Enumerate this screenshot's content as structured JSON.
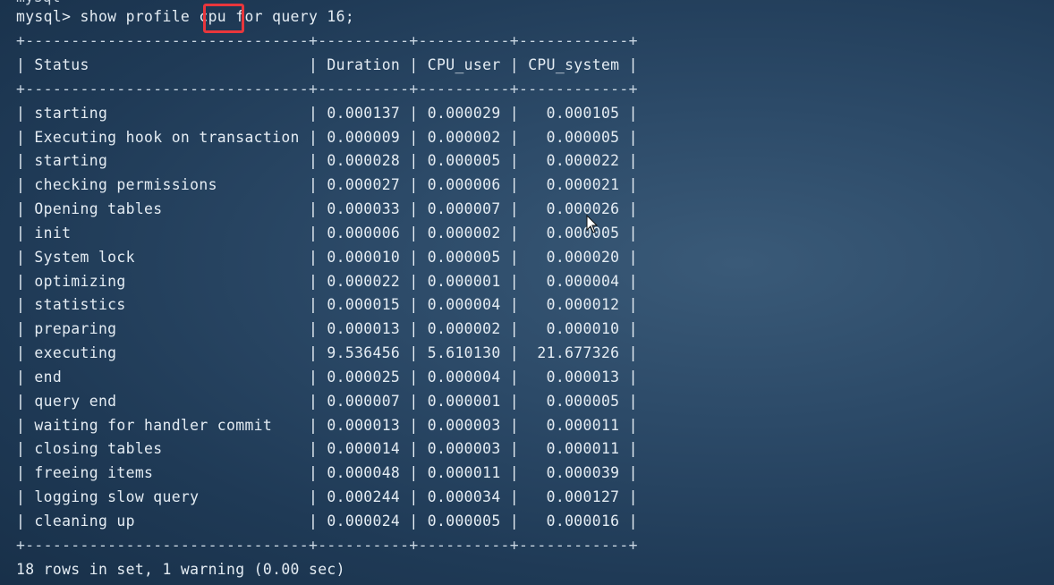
{
  "terminal": {
    "prev_prompt_fragment": "mysql",
    "command_line": "mysql> show profile cpu for query 16;",
    "highlighted_word": "cpu",
    "border": "+-------------------------------+----------+----------+------------+",
    "header_row": "| Status                        | Duration | CPU_user | CPU_system |",
    "rows": [
      "| starting                      | 0.000137 | 0.000029 |   0.000105 |",
      "| Executing hook on transaction | 0.000009 | 0.000002 |   0.000005 |",
      "| starting                      | 0.000028 | 0.000005 |   0.000022 |",
      "| checking permissions          | 0.000027 | 0.000006 |   0.000021 |",
      "| Opening tables                | 0.000033 | 0.000007 |   0.000026 |",
      "| init                          | 0.000006 | 0.000002 |   0.000005 |",
      "| System lock                   | 0.000010 | 0.000005 |   0.000020 |",
      "| optimizing                    | 0.000022 | 0.000001 |   0.000004 |",
      "| statistics                    | 0.000015 | 0.000004 |   0.000012 |",
      "| preparing                     | 0.000013 | 0.000002 |   0.000010 |",
      "| executing                     | 9.536456 | 5.610130 |  21.677326 |",
      "| end                           | 0.000025 | 0.000004 |   0.000013 |",
      "| query end                     | 0.000007 | 0.000001 |   0.000005 |",
      "| waiting for handler commit    | 0.000013 | 0.000003 |   0.000011 |",
      "| closing tables                | 0.000014 | 0.000003 |   0.000011 |",
      "| freeing items                 | 0.000048 | 0.000011 |   0.000039 |",
      "| logging slow query            | 0.000244 | 0.000034 |   0.000127 |",
      "| cleaning up                   | 0.000024 | 0.000005 |   0.000016 |"
    ],
    "result_summary": "18 rows in set, 1 warning (0.00 sec)",
    "colors": {
      "text": "#e4ecf3",
      "highlight_box": "#e8363c",
      "background": "#2c4a68"
    }
  }
}
